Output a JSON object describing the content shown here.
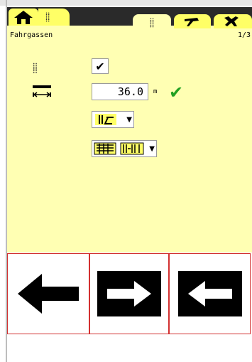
{
  "app": {
    "title": "Fahrgassen",
    "page_indicator": "1/3"
  },
  "tabs": [
    {
      "icon": "tramlines-icon",
      "active": true
    },
    {
      "icon": "tool-icon",
      "active": false
    },
    {
      "icon": "wrench-settings-icon",
      "active": false
    }
  ],
  "settings": {
    "tramline_enabled": "✔",
    "track_width_value": "36.0",
    "track_width_unit": "m",
    "confirm_symbol": "✔"
  },
  "colors": {
    "panel_bg": "#ffffb3",
    "tab_yellow": "#ffff66",
    "topbar": "#2a2a2a",
    "confirm_green": "#22a022",
    "button_border": "#d23030"
  },
  "nav_buttons": [
    {
      "icon": "arrow-left-icon",
      "style": "black-on-white"
    },
    {
      "icon": "arrow-right-icon",
      "style": "white-on-black"
    },
    {
      "icon": "arrow-left-icon",
      "style": "white-on-black"
    }
  ]
}
